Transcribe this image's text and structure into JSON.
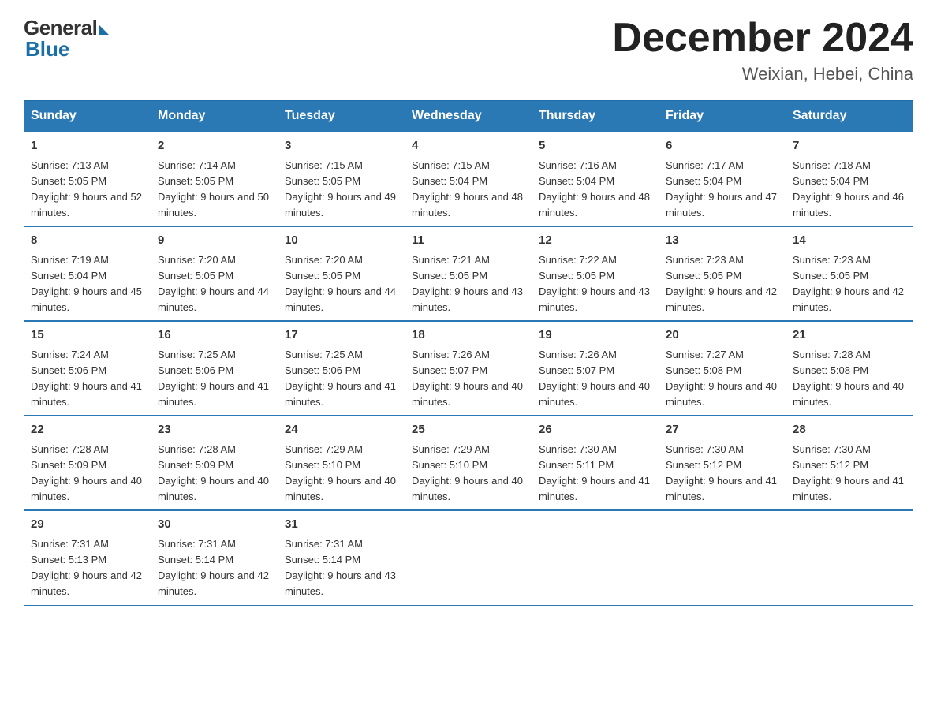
{
  "header": {
    "logo_general": "General",
    "logo_blue": "Blue",
    "month_title": "December 2024",
    "location": "Weixian, Hebei, China"
  },
  "calendar": {
    "days_of_week": [
      "Sunday",
      "Monday",
      "Tuesday",
      "Wednesday",
      "Thursday",
      "Friday",
      "Saturday"
    ],
    "weeks": [
      [
        {
          "day": "1",
          "sunrise": "7:13 AM",
          "sunset": "5:05 PM",
          "daylight": "9 hours and 52 minutes."
        },
        {
          "day": "2",
          "sunrise": "7:14 AM",
          "sunset": "5:05 PM",
          "daylight": "9 hours and 50 minutes."
        },
        {
          "day": "3",
          "sunrise": "7:15 AM",
          "sunset": "5:05 PM",
          "daylight": "9 hours and 49 minutes."
        },
        {
          "day": "4",
          "sunrise": "7:15 AM",
          "sunset": "5:04 PM",
          "daylight": "9 hours and 48 minutes."
        },
        {
          "day": "5",
          "sunrise": "7:16 AM",
          "sunset": "5:04 PM",
          "daylight": "9 hours and 48 minutes."
        },
        {
          "day": "6",
          "sunrise": "7:17 AM",
          "sunset": "5:04 PM",
          "daylight": "9 hours and 47 minutes."
        },
        {
          "day": "7",
          "sunrise": "7:18 AM",
          "sunset": "5:04 PM",
          "daylight": "9 hours and 46 minutes."
        }
      ],
      [
        {
          "day": "8",
          "sunrise": "7:19 AM",
          "sunset": "5:04 PM",
          "daylight": "9 hours and 45 minutes."
        },
        {
          "day": "9",
          "sunrise": "7:20 AM",
          "sunset": "5:05 PM",
          "daylight": "9 hours and 44 minutes."
        },
        {
          "day": "10",
          "sunrise": "7:20 AM",
          "sunset": "5:05 PM",
          "daylight": "9 hours and 44 minutes."
        },
        {
          "day": "11",
          "sunrise": "7:21 AM",
          "sunset": "5:05 PM",
          "daylight": "9 hours and 43 minutes."
        },
        {
          "day": "12",
          "sunrise": "7:22 AM",
          "sunset": "5:05 PM",
          "daylight": "9 hours and 43 minutes."
        },
        {
          "day": "13",
          "sunrise": "7:23 AM",
          "sunset": "5:05 PM",
          "daylight": "9 hours and 42 minutes."
        },
        {
          "day": "14",
          "sunrise": "7:23 AM",
          "sunset": "5:05 PM",
          "daylight": "9 hours and 42 minutes."
        }
      ],
      [
        {
          "day": "15",
          "sunrise": "7:24 AM",
          "sunset": "5:06 PM",
          "daylight": "9 hours and 41 minutes."
        },
        {
          "day": "16",
          "sunrise": "7:25 AM",
          "sunset": "5:06 PM",
          "daylight": "9 hours and 41 minutes."
        },
        {
          "day": "17",
          "sunrise": "7:25 AM",
          "sunset": "5:06 PM",
          "daylight": "9 hours and 41 minutes."
        },
        {
          "day": "18",
          "sunrise": "7:26 AM",
          "sunset": "5:07 PM",
          "daylight": "9 hours and 40 minutes."
        },
        {
          "day": "19",
          "sunrise": "7:26 AM",
          "sunset": "5:07 PM",
          "daylight": "9 hours and 40 minutes."
        },
        {
          "day": "20",
          "sunrise": "7:27 AM",
          "sunset": "5:08 PM",
          "daylight": "9 hours and 40 minutes."
        },
        {
          "day": "21",
          "sunrise": "7:28 AM",
          "sunset": "5:08 PM",
          "daylight": "9 hours and 40 minutes."
        }
      ],
      [
        {
          "day": "22",
          "sunrise": "7:28 AM",
          "sunset": "5:09 PM",
          "daylight": "9 hours and 40 minutes."
        },
        {
          "day": "23",
          "sunrise": "7:28 AM",
          "sunset": "5:09 PM",
          "daylight": "9 hours and 40 minutes."
        },
        {
          "day": "24",
          "sunrise": "7:29 AM",
          "sunset": "5:10 PM",
          "daylight": "9 hours and 40 minutes."
        },
        {
          "day": "25",
          "sunrise": "7:29 AM",
          "sunset": "5:10 PM",
          "daylight": "9 hours and 40 minutes."
        },
        {
          "day": "26",
          "sunrise": "7:30 AM",
          "sunset": "5:11 PM",
          "daylight": "9 hours and 41 minutes."
        },
        {
          "day": "27",
          "sunrise": "7:30 AM",
          "sunset": "5:12 PM",
          "daylight": "9 hours and 41 minutes."
        },
        {
          "day": "28",
          "sunrise": "7:30 AM",
          "sunset": "5:12 PM",
          "daylight": "9 hours and 41 minutes."
        }
      ],
      [
        {
          "day": "29",
          "sunrise": "7:31 AM",
          "sunset": "5:13 PM",
          "daylight": "9 hours and 42 minutes."
        },
        {
          "day": "30",
          "sunrise": "7:31 AM",
          "sunset": "5:14 PM",
          "daylight": "9 hours and 42 minutes."
        },
        {
          "day": "31",
          "sunrise": "7:31 AM",
          "sunset": "5:14 PM",
          "daylight": "9 hours and 43 minutes."
        },
        null,
        null,
        null,
        null
      ]
    ]
  }
}
